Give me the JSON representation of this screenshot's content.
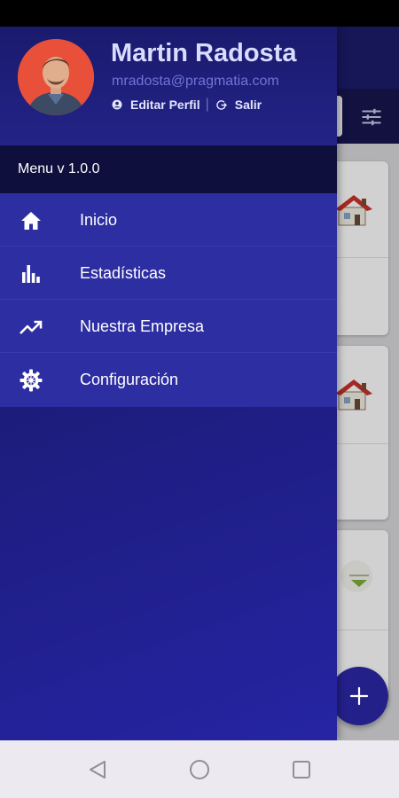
{
  "profile": {
    "name": "Martin Radosta",
    "email": "mradosta@pragmatia.com",
    "edit_label": "Editar Perfil",
    "separator": "|",
    "logout_label": "Salir"
  },
  "menu_version": "Menu v 1.0.0",
  "menu": {
    "items": [
      {
        "label": "Inicio",
        "icon": "home-icon"
      },
      {
        "label": "Estadísticas",
        "icon": "bar-chart-icon"
      },
      {
        "label": "Nuestra Empresa",
        "icon": "trending-up-icon"
      },
      {
        "label": "Configuración",
        "icon": "gear-icon"
      }
    ]
  },
  "background_screen": {
    "fab_icon": "plus-icon",
    "filter_icon": "tune-icon"
  },
  "navigation": {
    "back": "back-triangle-icon",
    "home": "home-circle-icon",
    "recents": "recents-square-icon"
  },
  "colors": {
    "drawer": "#1c1c7a",
    "menu": "#2d2ea1",
    "version_bar": "#0f0f3e",
    "accent_email": "#6f74d6",
    "fab": "#24208a"
  }
}
